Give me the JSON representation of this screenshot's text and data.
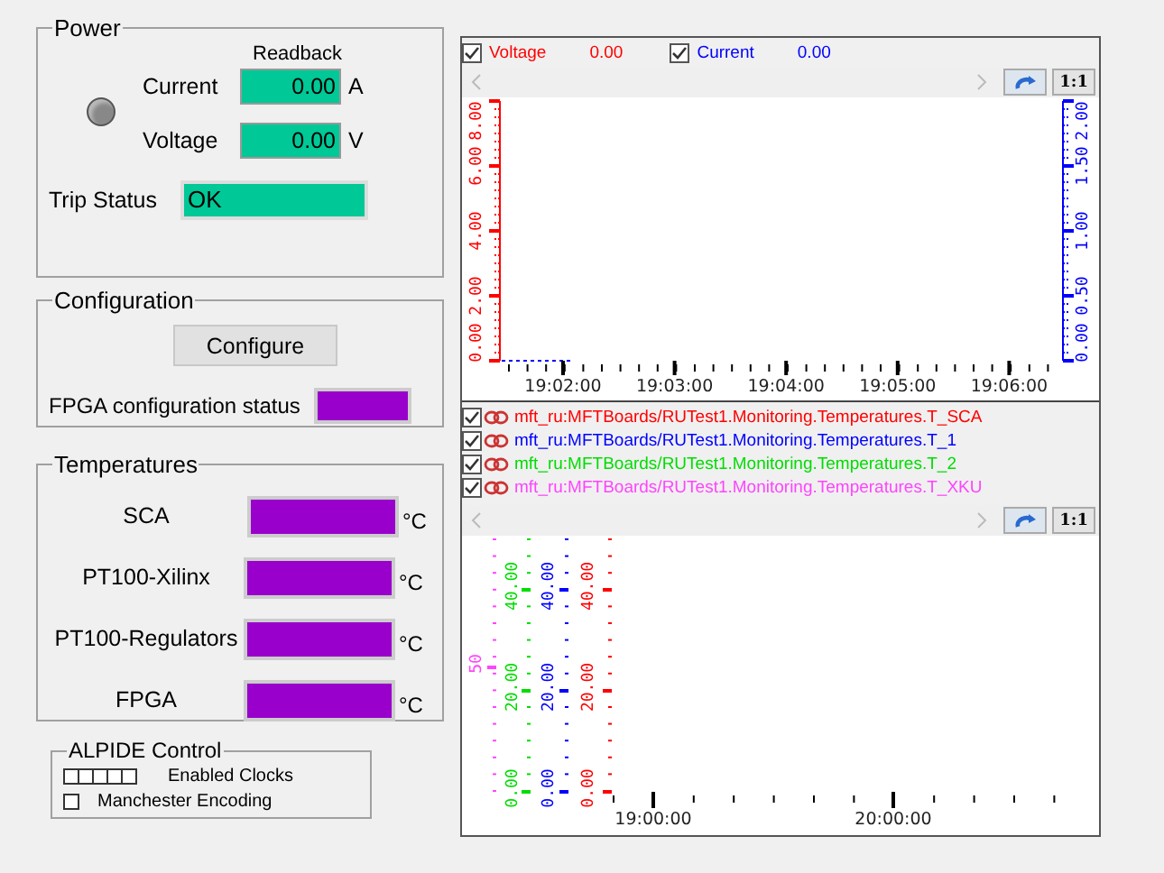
{
  "power": {
    "title": "Power",
    "readback_label": "Readback",
    "indicator": {
      "on": false
    },
    "readings": [
      {
        "label": "Current",
        "value": "0.00",
        "unit": "A"
      },
      {
        "label": "Voltage",
        "value": "0.00",
        "unit": "V"
      }
    ],
    "trip_status": {
      "label": "Trip Status",
      "value": "OK"
    }
  },
  "configuration": {
    "title": "Configuration",
    "button": "Configure",
    "status_label": "FPGA configuration status"
  },
  "temperatures": {
    "title": "Temperatures",
    "rows": [
      {
        "label": "SCA",
        "unit": "°C"
      },
      {
        "label": "PT100-Xilinx",
        "unit": "°C"
      },
      {
        "label": "PT100-Regulators",
        "unit": "°C"
      },
      {
        "label": "FPGA",
        "unit": "°C"
      }
    ]
  },
  "alpide": {
    "title": "ALPIDE Control",
    "clocks": [
      {
        "checked": false
      },
      {
        "checked": false
      },
      {
        "checked": false
      },
      {
        "checked": false
      },
      {
        "checked": false
      }
    ],
    "clocks_label": "Enabled Clocks",
    "manchester": {
      "label": "Manchester Encoding",
      "checked": false
    }
  },
  "trend_top": {
    "legend": [
      {
        "label": "Voltage",
        "value": "0.00",
        "checked": true,
        "color": "#ff0000"
      },
      {
        "label": "Current",
        "value": "0.00",
        "checked": true,
        "color": "#0000ff"
      }
    ],
    "zoom_button": "1:1",
    "axes": [
      {
        "color": "#ff0000",
        "ticks": [
          "0.00",
          "2.00",
          "4.00",
          "6.00",
          "8.00"
        ]
      },
      {
        "color": "#0000ff",
        "ticks": [
          "0.00",
          "0.50",
          "1.00",
          "1.50",
          "2.00"
        ]
      }
    ],
    "x_ticks": [
      "19:02:00",
      "19:03:00",
      "19:04:00",
      "19:05:00",
      "19:06:00"
    ]
  },
  "trend_bottom": {
    "legend": [
      {
        "label": "mft_ru:MFTBoards/RUTest1.Monitoring.Temperatures.T_SCA",
        "checked": true,
        "color": "#ff0000"
      },
      {
        "label": "mft_ru:MFTBoards/RUTest1.Monitoring.Temperatures.T_1",
        "checked": true,
        "color": "#0000ff"
      },
      {
        "label": "mft_ru:MFTBoards/RUTest1.Monitoring.Temperatures.T_2",
        "checked": true,
        "color": "#00dd00"
      },
      {
        "label": "mft_ru:MFTBoards/RUTest1.Monitoring.Temperatures.T_XKU",
        "checked": true,
        "color": "#ff44ff"
      }
    ],
    "zoom_button": "1:1",
    "axes": [
      {
        "color": "#ff44ff",
        "ticks": [
          "50"
        ]
      },
      {
        "color": "#00dd00",
        "ticks": [
          "0.00",
          "20.00",
          "40.00"
        ]
      },
      {
        "color": "#0000ff",
        "ticks": [
          "0.00",
          "20.00",
          "40.00"
        ]
      },
      {
        "color": "#ff0000",
        "ticks": [
          "0.00",
          "20.00",
          "40.00"
        ]
      }
    ],
    "x_ticks": [
      "19:00:00",
      "20:00:00"
    ]
  }
}
